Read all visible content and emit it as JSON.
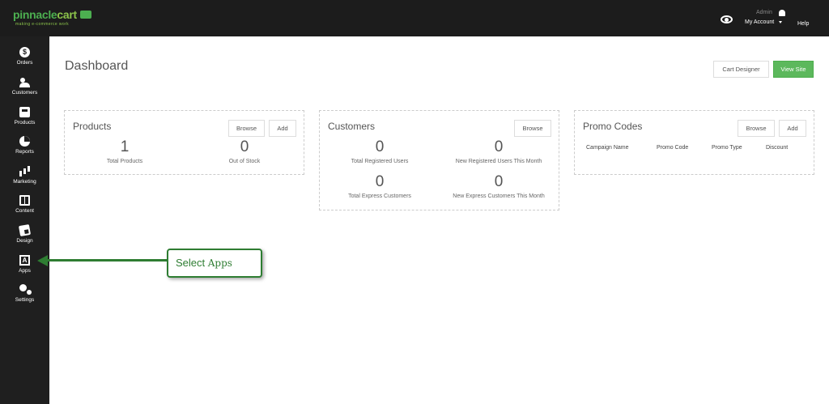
{
  "header": {
    "logo_text_main": "pinnacle",
    "logo_text_cart": "cart",
    "logo_tagline": "making e-commerce work",
    "admin_label": "Admin",
    "account_label": "My Account",
    "help_label": "Help",
    "bg_color": "#1c1c1c",
    "brand_green": "#4caf50"
  },
  "sidebar": {
    "items": [
      {
        "label": "Orders",
        "icon": "dollar-circle-icon"
      },
      {
        "label": "Customers",
        "icon": "users-icon"
      },
      {
        "label": "Products",
        "icon": "tag-icon"
      },
      {
        "label": "Reports",
        "icon": "pie-chart-icon"
      },
      {
        "label": "Marketing",
        "icon": "bar-chart-icon"
      },
      {
        "label": "Content",
        "icon": "book-icon"
      },
      {
        "label": "Design",
        "icon": "paint-icon"
      },
      {
        "label": "Apps",
        "icon": "apps-icon"
      },
      {
        "label": "Settings",
        "icon": "gears-icon"
      }
    ]
  },
  "main": {
    "title": "Dashboard",
    "cart_designer_label": "Cart Designer",
    "view_site_label": "View Site"
  },
  "cards": {
    "products": {
      "title": "Products",
      "browse_label": "Browse",
      "add_label": "Add",
      "stats": [
        {
          "value": "1",
          "label": "Total Products"
        },
        {
          "value": "0",
          "label": "Out of Stock"
        }
      ]
    },
    "customers": {
      "title": "Customers",
      "browse_label": "Browse",
      "stats": [
        {
          "value": "0",
          "label": "Total Registered Users"
        },
        {
          "value": "0",
          "label": "New Registered Users This Month"
        },
        {
          "value": "0",
          "label": "Total Express Customers"
        },
        {
          "value": "0",
          "label": "New Express Customers This Month"
        }
      ]
    },
    "promo": {
      "title": "Promo Codes",
      "browse_label": "Browse",
      "add_label": "Add",
      "columns": [
        "Campaign Name",
        "Promo Code",
        "Promo Type",
        "Discount"
      ]
    }
  },
  "callout": {
    "text_word1": "Select",
    "text_word2": "Apps",
    "color": "#2e7d32"
  }
}
